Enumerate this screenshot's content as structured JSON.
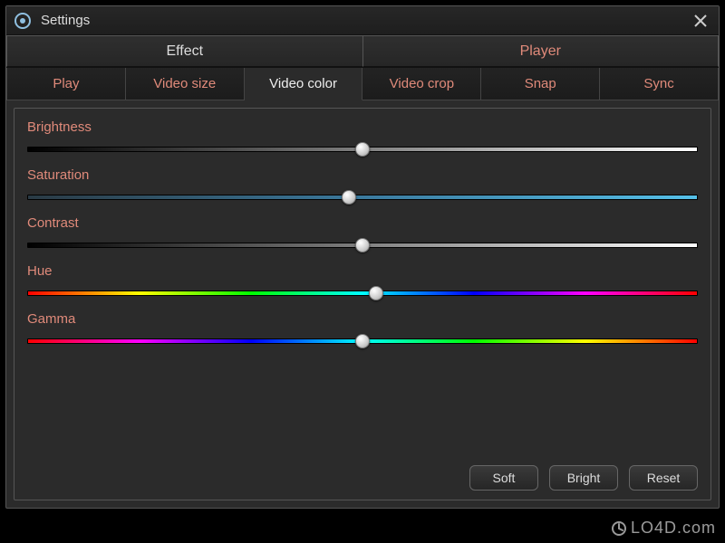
{
  "window": {
    "title": "Settings"
  },
  "main_tabs": [
    {
      "label": "Effect",
      "active": true
    },
    {
      "label": "Player",
      "active": false
    }
  ],
  "sub_tabs": [
    {
      "label": "Play",
      "active": false
    },
    {
      "label": "Video size",
      "active": false
    },
    {
      "label": "Video color",
      "active": true
    },
    {
      "label": "Video crop",
      "active": false
    },
    {
      "label": "Snap",
      "active": false
    },
    {
      "label": "Sync",
      "active": false
    }
  ],
  "sliders": [
    {
      "label": "Brightness",
      "value": 50,
      "track": "brightness"
    },
    {
      "label": "Saturation",
      "value": 48,
      "track": "saturation"
    },
    {
      "label": "Contrast",
      "value": 50,
      "track": "contrast"
    },
    {
      "label": "Hue",
      "value": 52,
      "track": "hue"
    },
    {
      "label": "Gamma",
      "value": 50,
      "track": "gamma"
    }
  ],
  "buttons": {
    "soft": "Soft",
    "bright": "Bright",
    "reset": "Reset"
  },
  "watermark": "LO4D.com"
}
